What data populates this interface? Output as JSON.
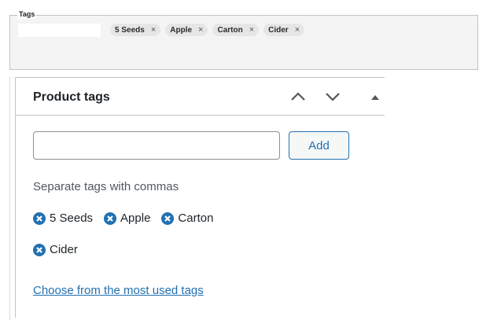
{
  "top_tags": {
    "legend": "Tags",
    "chips": [
      {
        "label": "5 Seeds",
        "remove": "×"
      },
      {
        "label": "Apple",
        "remove": "×"
      },
      {
        "label": "Carton",
        "remove": "×"
      },
      {
        "label": "Cider",
        "remove": "×"
      }
    ]
  },
  "panel": {
    "title": "Product tags",
    "input": {
      "value": "",
      "placeholder": ""
    },
    "add_label": "Add",
    "hint": "Separate tags with commas",
    "tags": [
      "5 Seeds",
      "Apple",
      "Carton",
      "Cider"
    ],
    "choose_link": "Choose from the most used tags"
  },
  "icons": {
    "remove": "remove-circle-icon",
    "move_up": "chevron-up-icon",
    "move_down": "chevron-down-icon",
    "toggle": "caret-up-icon"
  },
  "colors": {
    "link": "#2271b1",
    "remove_icon": "#2271b1",
    "chip_bg": "#e6e6e6",
    "box_bg": "#f4f4f4"
  }
}
